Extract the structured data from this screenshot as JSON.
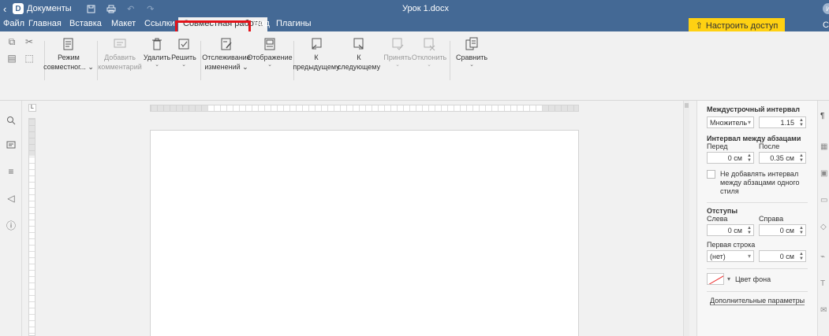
{
  "titlebar": {
    "app_title": "Документы",
    "doc_title": "Урок 1.docx",
    "icons": [
      "back-chevron-icon",
      "save-icon",
      "print-icon",
      "undo-icon",
      "redo-icon"
    ]
  },
  "menu": {
    "tabs": [
      "Файл",
      "Главная",
      "Вставка",
      "Макет",
      "Ссылки",
      "Совместная работа",
      "Вид",
      "Плагины"
    ],
    "active_tab": "Совместная работа",
    "access_button": "Настроить доступ",
    "right_glyph": "С"
  },
  "toolbar": {
    "review_mode": {
      "line1": "Режим",
      "line2": "совместног... ⌄"
    },
    "add_comment": {
      "line1": "Добавить",
      "line2": "комментарий"
    },
    "delete": {
      "label": "Удалить"
    },
    "resolve": {
      "label": "Решить"
    },
    "track_changes": {
      "line1": "Отслеживание",
      "line2": "изменений ⌄"
    },
    "display": {
      "label": "Отображение"
    },
    "prev": {
      "line1": "К",
      "line2": "предыдущему"
    },
    "next": {
      "line1": "К",
      "line2": "следующему"
    },
    "accept": {
      "label": "Принять"
    },
    "reject": {
      "label": "Отклонить"
    },
    "compare": {
      "label": "Сравнить"
    }
  },
  "right_panel": {
    "line_spacing_title": "Междустрочный интервал",
    "line_spacing_mode": "Множитель",
    "line_spacing_value": "1.15",
    "para_spacing_title": "Интервал между абзацами",
    "before_label": "Перед",
    "after_label": "После",
    "before_value": "0 см",
    "after_value": "0.35 см",
    "no_spacing_same_style": "Не добавлять интервал между абзацами одного стиля",
    "indents_title": "Отступы",
    "left_label": "Слева",
    "right_label": "Справа",
    "left_value": "0 см",
    "right_value": "0 см",
    "first_line_label": "Первая строка",
    "first_line_mode": "(нет)",
    "first_line_value": "0 см",
    "bg_color_label": "Цвет фона",
    "advanced_link": "Дополнительные параметры"
  },
  "colors": {
    "titlebar": "#446995",
    "access_button": "#ffd112",
    "highlight": "#e4131a"
  }
}
